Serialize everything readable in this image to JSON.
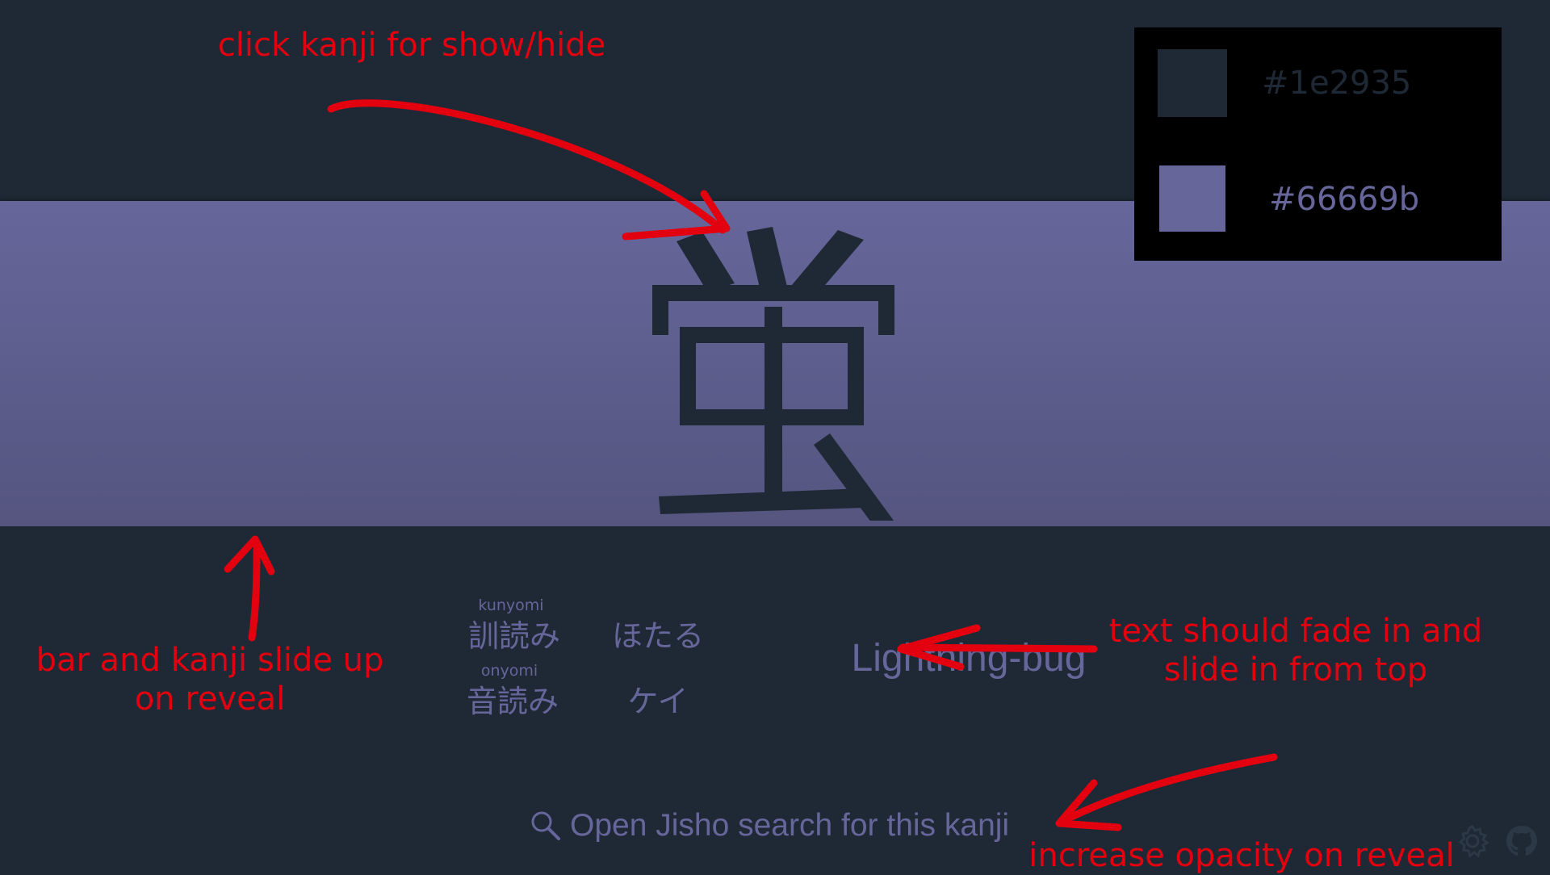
{
  "kanji": {
    "character": "蛍"
  },
  "palette": {
    "background": "#1e2935",
    "accent": "#66669b",
    "swatches": [
      {
        "color": "#1e2935",
        "label": "#1e2935"
      },
      {
        "color": "#66669b",
        "label": "#66669b"
      }
    ]
  },
  "readings": {
    "kunyomi": {
      "label_small": "kunyomi",
      "label": "訓読み",
      "value": "ほたる"
    },
    "onyomi": {
      "label_small": "onyomi",
      "label": "音読み",
      "value": "ケイ"
    }
  },
  "meaning": "Lightning-bug",
  "jisho": {
    "label": "Open Jisho search for this kanji",
    "icon": "search-icon"
  },
  "corner_icons": [
    "gear-icon",
    "github-icon"
  ],
  "annotations": {
    "kanji_note": "click kanji for show/hide",
    "bar_note": "bar and kanji slide up\non reveal",
    "text_note": "text should fade in and\nslide in from top",
    "opacity_note": "increase opacity on reveal"
  },
  "annotation_color": "#e3000f"
}
